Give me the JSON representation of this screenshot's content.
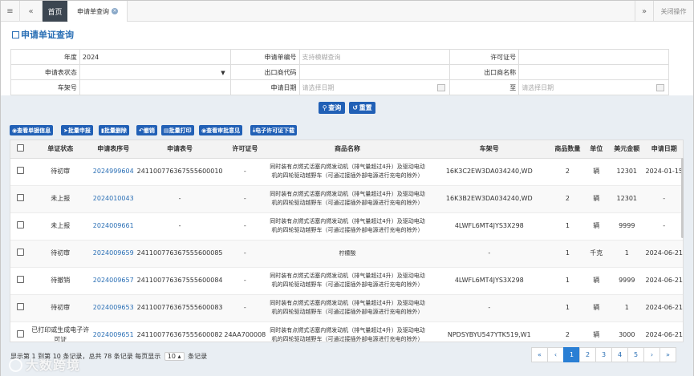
{
  "topbar": {
    "menu_icon": "hamburger-icon",
    "prev_icon": "double-left-icon",
    "home_tab": "首页",
    "current_tab": "申请单查询",
    "close_icon": "close-circle-icon",
    "next_icon": "double-right-icon",
    "close_ops": "关闭操作"
  },
  "page": {
    "title": "申请单证查询",
    "title_icon": "edit-icon"
  },
  "form": {
    "year_label": "年度",
    "year_value": "2024",
    "app_no_label": "申请单编号",
    "app_no_placeholder": "支持模糊查询",
    "license_label": "许可证号",
    "status_label": "申请表状态",
    "exporter_code_label": "出口商代码",
    "exporter_name_label": "出口商名称",
    "vin_label": "车架号",
    "date_label": "申请日期",
    "date_placeholder": "请选择日期",
    "to_label": "至",
    "date2_placeholder": "请选择日期"
  },
  "search": {
    "query_label": "查询",
    "reset_label": "重置"
  },
  "actions": [
    "查看单据信息",
    "批量申报",
    "批量删除",
    "撤销",
    "批量打印",
    "查看审批意见",
    "电子许可证下载"
  ],
  "table": {
    "headers": [
      "",
      "单证状态",
      "申请表序号",
      "申请表号",
      "许可证号",
      "商品名称",
      "车架号",
      "商品数量",
      "单位",
      "美元金额",
      "申请日期"
    ],
    "rows": [
      {
        "status": "待初审",
        "seq": "2024999604",
        "app_no": "241100776367555600010",
        "license": "-",
        "name": "同时装有点燃式活塞内燃发动机（排气量超过4升）及驱动电动机的四轮驱动越野车（可通过接插外部电源进行充电的除外）",
        "vin": "16K3C2EW3DA034240,WD",
        "qty": "2",
        "unit": "辆",
        "usd": "12301",
        "date": "2024-01-15"
      },
      {
        "status": "未上报",
        "seq": "2024010043",
        "app_no": "-",
        "license": "-",
        "name": "同时装有点燃式活塞内燃发动机（排气量超过4升）及驱动电动机的四轮驱动越野车（可通过接插外部电源进行充电的除外）",
        "vin": "16K3B2EW3DA034240,WD",
        "qty": "2",
        "unit": "辆",
        "usd": "12301",
        "date": "-"
      },
      {
        "status": "未上报",
        "seq": "2024009661",
        "app_no": "-",
        "license": "-",
        "name": "同时装有点燃式活塞内燃发动机（排气量超过4升）及驱动电动机的四轮驱动越野车（可通过接插外部电源进行充电的除外）",
        "vin": "4LWFL6MT4JYS3X298",
        "qty": "1",
        "unit": "辆",
        "usd": "9999",
        "date": "-"
      },
      {
        "status": "待初审",
        "seq": "2024009659",
        "app_no": "241100776367555600085",
        "license": "-",
        "name": "柠檬酸",
        "vin": "-",
        "qty": "1",
        "unit": "千克",
        "usd": "1",
        "date": "2024-06-21"
      },
      {
        "status": "待撤销",
        "seq": "2024009657",
        "app_no": "241100776367555600084",
        "license": "-",
        "name": "同时装有点燃式活塞内燃发动机（排气量超过4升）及驱动电动机的四轮驱动越野车（可通过接插外部电源进行充电的除外）",
        "vin": "4LWFL6MT4JYS3X298",
        "qty": "1",
        "unit": "辆",
        "usd": "9999",
        "date": "2024-06-21"
      },
      {
        "status": "待初审",
        "seq": "2024009653",
        "app_no": "241100776367555600083",
        "license": "-",
        "name": "同时装有点燃式活塞内燃发动机（排气量超过4升）及驱动电动机的四轮驱动越野车（可通过接插外部电源进行充电的除外）",
        "vin": "-",
        "qty": "1",
        "unit": "辆",
        "usd": "1",
        "date": "2024-06-21"
      },
      {
        "status": "已打印或生成电子许可证",
        "seq": "2024009651",
        "app_no": "241100776367555600082",
        "license": "24AA700008",
        "name": "同时装有点燃式活塞内燃发动机（排气量超过4升）及驱动电动机的四轮驱动越野车（可通过接插外部电源进行充电的除外）",
        "vin": "NPDSYBYU547YTK519,W1",
        "qty": "2",
        "unit": "辆",
        "usd": "3000",
        "date": "2024-06-21"
      }
    ]
  },
  "pagination": {
    "info_prefix": "显示第 1 到第 10 条记录，总共 78 条记录 每页显示",
    "per_page": "10",
    "info_suffix": "条记录",
    "pages": [
      "«",
      "‹",
      "1",
      "2",
      "3",
      "4",
      "5",
      "›",
      "»"
    ],
    "active": "1"
  },
  "watermark": {
    "text": "大数跨境",
    "logo_icon": "brand-logo-icon"
  }
}
